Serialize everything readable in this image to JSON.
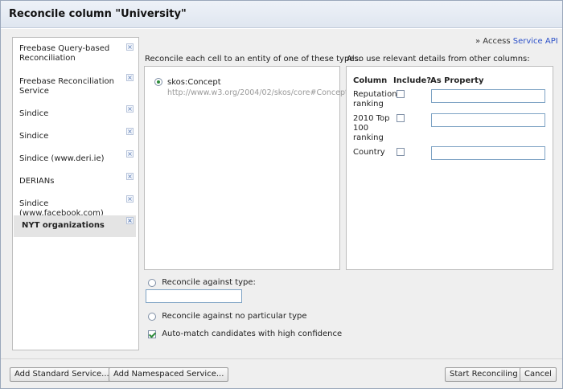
{
  "dialog": {
    "title": "Reconcile column \"University\""
  },
  "services": [
    {
      "label": "Freebase Query-based Reconciliation",
      "selected": false
    },
    {
      "label": "Freebase Reconciliation Service",
      "selected": false
    },
    {
      "label": "Sindice",
      "selected": false
    },
    {
      "label": "Sindice",
      "selected": false
    },
    {
      "label": "Sindice (www.deri.ie)",
      "selected": false
    },
    {
      "label": "DERIANs",
      "selected": false
    },
    {
      "label": "Sindice (www.facebook.com)",
      "selected": false
    },
    {
      "label": "NYT organizations",
      "selected": true
    }
  ],
  "remove_icon_glyph": "×",
  "access": {
    "prefix": "» Access",
    "link": "Service API"
  },
  "types_header": "Reconcile each cell to an entity of one of these types:",
  "columns_header": "Also use relevant details from other columns:",
  "types": [
    {
      "name": "skos:Concept",
      "uri": "http://www.w3.org/2004/02/skos/core#Concept",
      "selected": true
    }
  ],
  "columns_table": {
    "headers": {
      "column": "Column",
      "include": "Include?",
      "property": "As Property"
    },
    "rows": [
      {
        "name": "Reputation ranking",
        "include": false,
        "property": ""
      },
      {
        "name": "2010 Top 100 ranking",
        "include": false,
        "property": ""
      },
      {
        "name": "Country",
        "include": false,
        "property": ""
      }
    ]
  },
  "options": {
    "against_type": "Reconcile against type:",
    "type_value": "",
    "no_type": "Reconcile against no particular type",
    "auto_match": "Auto-match candidates with high confidence",
    "auto_match_checked": true
  },
  "buttons": {
    "add_standard": "Add Standard Service...",
    "add_namespaced": "Add Namespaced Service...",
    "start": "Start Reconciling",
    "cancel": "Cancel"
  },
  "colors": {
    "link": "#2b50c8",
    "check": "#2e8b3a"
  }
}
